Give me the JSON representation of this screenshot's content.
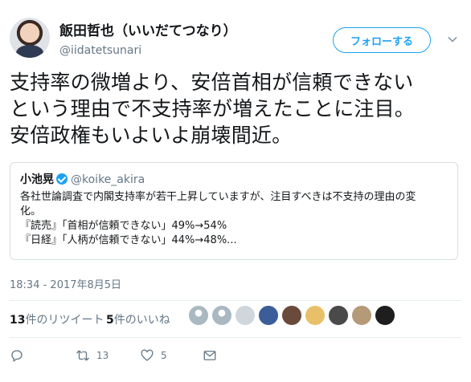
{
  "author": {
    "display_name": "飯田哲也（いいだてつなり）",
    "screen_name": "@iidatetsunari"
  },
  "follow_button": {
    "label": "フォローする"
  },
  "tweet_text": "支持率の微増より、安倍首相が信頼できない\nという理由で不支持率が増えたことに注目。\n安倍政権もいよいよ崩壊間近。",
  "quote": {
    "name": "小池晃",
    "handle": "@koike_akira",
    "text": "各社世論調査で内閣支持率が若干上昇していますが、注目すべきは不支持の理由の変\n化。\n『読売』「首相が信頼できない」49%→54%\n『日経』「人柄が信頼できない」44%→48%..."
  },
  "timestamp": "18:34 - 2017年8月5日",
  "stats": {
    "retweet_count": "13",
    "retweet_label": "件のリツイート",
    "like_count": "5",
    "like_label": "件のいいね"
  },
  "liker_avatars": [
    {
      "icon": "default-avatar-icon",
      "color": "#aab8c2"
    },
    {
      "icon": "default-avatar-icon",
      "color": "#aab8c2"
    },
    {
      "icon": "avatar-photo-icon",
      "color": "#cfd6dc"
    },
    {
      "icon": "avatar-photo-icon",
      "color": "#3b5e9a"
    },
    {
      "icon": "avatar-photo-icon",
      "color": "#6a4a3a"
    },
    {
      "icon": "avatar-photo-icon",
      "color": "#e8c06a"
    },
    {
      "icon": "avatar-photo-icon",
      "color": "#4a4a4a"
    },
    {
      "icon": "avatar-photo-icon",
      "color": "#b59a7a"
    },
    {
      "icon": "avatar-photo-icon",
      "color": "#1e1e1e"
    }
  ],
  "actions": {
    "reply_icon": "reply-icon",
    "retweet_icon": "retweet-icon",
    "retweet_count": "13",
    "like_icon": "heart-icon",
    "like_count": "5",
    "dm_icon": "envelope-icon"
  },
  "colors": {
    "accent": "#1da1f2",
    "secondary_text": "#657786",
    "border": "#e6ecf0"
  }
}
